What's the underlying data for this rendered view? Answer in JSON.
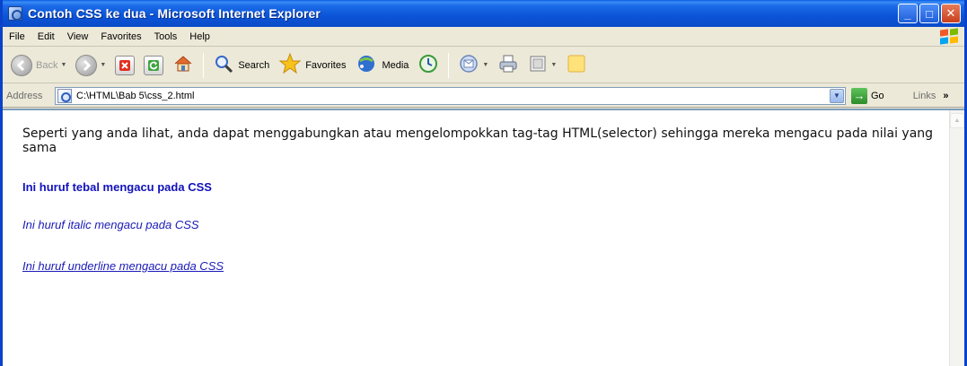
{
  "window": {
    "title": "Contoh CSS ke dua - Microsoft Internet Explorer",
    "min_glyph": "_",
    "max_glyph": "□",
    "close_glyph": "✕"
  },
  "menu": [
    "File",
    "Edit",
    "View",
    "Favorites",
    "Tools",
    "Help"
  ],
  "toolbar": {
    "back_label": "Back",
    "search_label": "Search",
    "favorites_label": "Favorites",
    "media_label": "Media"
  },
  "address": {
    "label": "Address",
    "url": "C:\\HTML\\Bab 5\\css_2.html",
    "go_label": "Go",
    "links_label": "Links",
    "links_more": "»"
  },
  "page": {
    "paragraph": "Seperti yang anda lihat, anda dapat menggabungkan atau mengelompokkan tag-tag HTML(selector) sehingga mereka mengacu pada nilai yang sama",
    "bold_line": "Ini huruf tebal mengacu pada CSS",
    "italic_line": "Ini huruf italic mengacu pada CSS",
    "underline_line": "Ini huruf underline mengacu pada CSS"
  },
  "colors": {
    "titlebar": "#0b54d8",
    "link_text": "#1a1ab8",
    "chrome": "#ece9d8"
  }
}
